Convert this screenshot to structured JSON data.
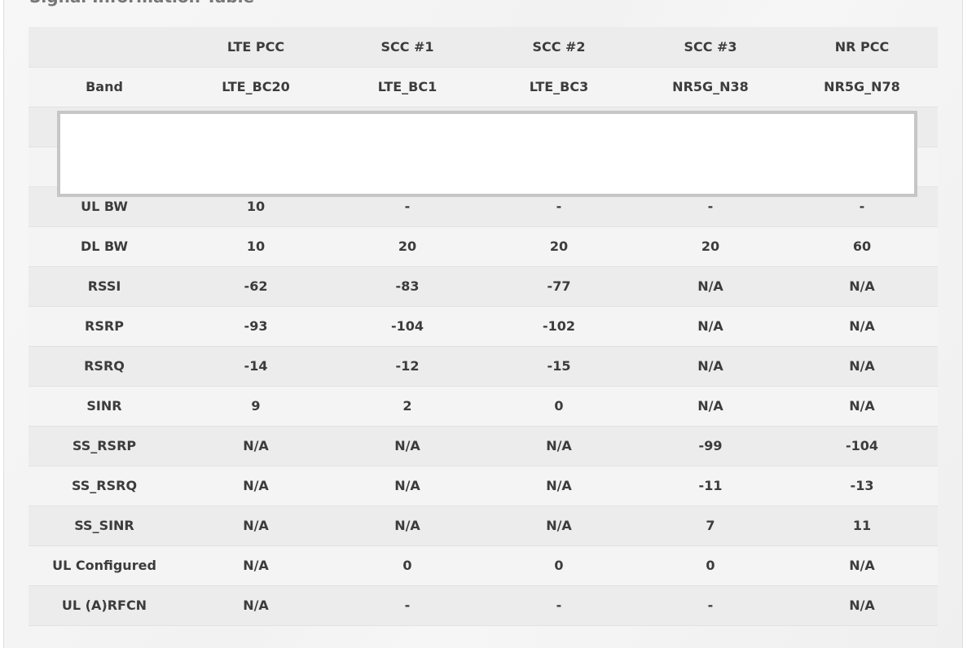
{
  "section": {
    "title": "Signal Information Table"
  },
  "table": {
    "headers": [
      "",
      "LTE PCC",
      "SCC #1",
      "SCC #2",
      "SCC #3",
      "NR PCC"
    ],
    "rows": [
      {
        "label": "Band",
        "values": [
          "LTE_BC20",
          "LTE_BC1",
          "LTE_BC3",
          "NR5G_N38",
          "NR5G_N78"
        ]
      },
      {
        "label": "",
        "values": [
          "",
          "",
          "",
          "",
          ""
        ]
      },
      {
        "label": "",
        "values": [
          "",
          "",
          "",
          "",
          ""
        ]
      },
      {
        "label": "UL BW",
        "values": [
          "10",
          "-",
          "-",
          "-",
          "-"
        ]
      },
      {
        "label": "DL BW",
        "values": [
          "10",
          "20",
          "20",
          "20",
          "60"
        ]
      },
      {
        "label": "RSSI",
        "values": [
          "-62",
          "-83",
          "-77",
          "N/A",
          "N/A"
        ]
      },
      {
        "label": "RSRP",
        "values": [
          "-93",
          "-104",
          "-102",
          "N/A",
          "N/A"
        ]
      },
      {
        "label": "RSRQ",
        "values": [
          "-14",
          "-12",
          "-15",
          "N/A",
          "N/A"
        ]
      },
      {
        "label": "SINR",
        "values": [
          "9",
          "2",
          "0",
          "N/A",
          "N/A"
        ]
      },
      {
        "label": "SS_RSRP",
        "values": [
          "N/A",
          "N/A",
          "N/A",
          "-99",
          "-104"
        ]
      },
      {
        "label": "SS_RSRQ",
        "values": [
          "N/A",
          "N/A",
          "N/A",
          "-11",
          "-13"
        ]
      },
      {
        "label": "SS_SINR",
        "values": [
          "N/A",
          "N/A",
          "N/A",
          "7",
          "11"
        ]
      },
      {
        "label": "UL Configured",
        "values": [
          "N/A",
          "0",
          "0",
          "0",
          "N/A"
        ]
      },
      {
        "label": "UL (A)RFCN",
        "values": [
          "N/A",
          "-",
          "-",
          "-",
          "N/A"
        ]
      }
    ]
  }
}
